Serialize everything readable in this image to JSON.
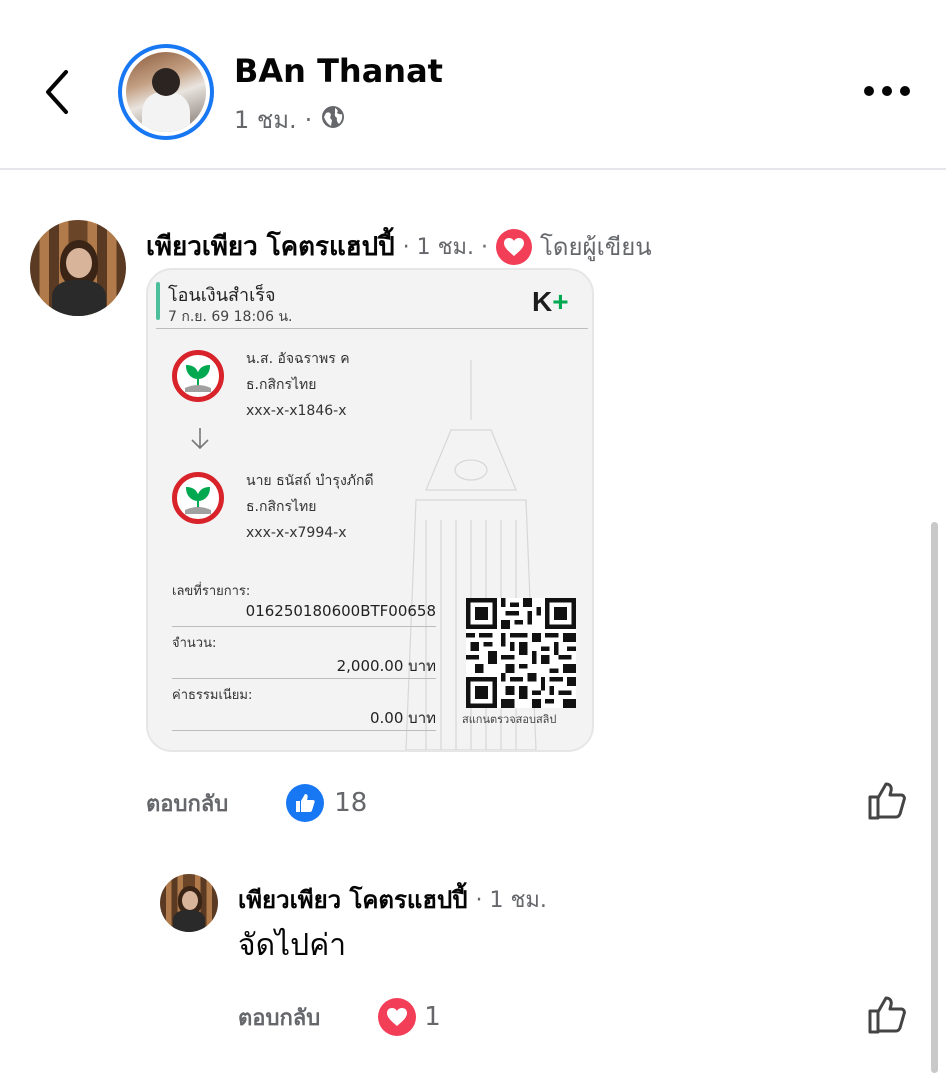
{
  "header": {
    "author": "BAn Thanat",
    "time": "1 ชม.",
    "separator": "·"
  },
  "comments": [
    {
      "name": "เพียวเพียว โคตรแฮปปี้",
      "time": "· 1 ชม. ·",
      "author_tag": "โดยผู้เขียน",
      "reply_label": "ตอบกลับ",
      "reaction": "like",
      "reaction_count": "18",
      "slip": {
        "title": "โอนเงินสำเร็จ",
        "date": "7 ก.ย. 69  18:06 น.",
        "brand": "K",
        "brand_plus": "+",
        "from": {
          "name": "น.ส. อัจฉราพร ค",
          "bank": "ธ.กสิกรไทย",
          "account": "xxx-x-x1846-x"
        },
        "to": {
          "name": "นาย ธนัสถ์ บำรุงภักดี",
          "bank": "ธ.กสิกรไทย",
          "account": "xxx-x-x7994-x"
        },
        "ref_label": "เลขที่รายการ:",
        "ref_value": "016250180600BTF00658",
        "amount_label": "จำนวน:",
        "amount_value": "2,000.00 บาท",
        "fee_label": "ค่าธรรมเนียม:",
        "fee_value": "0.00 บาท",
        "qr_caption": "สแกนตรวจสอบสลิป"
      }
    },
    {
      "name": "เพียวเพียว โคตรแฮปปี้",
      "time": "· 1 ชม.",
      "text": "จัดไปค่า",
      "reply_label": "ตอบกลับ",
      "reaction": "love",
      "reaction_count": "1"
    }
  ],
  "colors": {
    "facebook_blue": "#1877f2",
    "love_red": "#f33e58",
    "secondary_text": "#65676b",
    "kbank_green": "#00a950",
    "kbank_red": "#d8232a"
  },
  "icons": [
    "back-chevron-icon",
    "globe-icon",
    "more-dots-icon",
    "heart-icon",
    "like-thumb-icon",
    "thumbs-up-outline-icon",
    "down-arrow-icon",
    "kbank-logo-icon",
    "qr-code"
  ]
}
